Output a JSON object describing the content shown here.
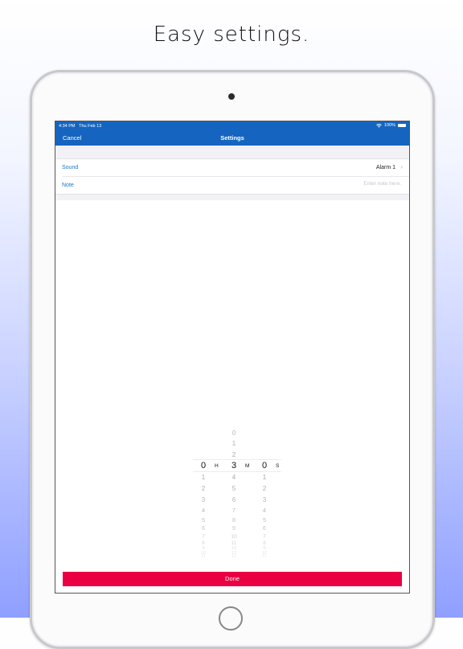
{
  "headline": "Easy settings.",
  "status": {
    "time": "4:34 PM",
    "date": "Thu Feb 13",
    "battery": "100%"
  },
  "nav": {
    "cancel": "Cancel",
    "title": "Settings"
  },
  "rows": {
    "sound": {
      "label": "Sound",
      "value": "Alarm 1"
    },
    "note": {
      "label": "Note",
      "placeholder": "Enter note here."
    }
  },
  "picker": {
    "hours": {
      "above": [],
      "selected": "0",
      "below": [
        "1",
        "2",
        "3",
        "4",
        "5",
        "6",
        "7",
        "8",
        "9",
        "10",
        "11"
      ],
      "unit": "H"
    },
    "minutes": {
      "above": [
        "0",
        "1",
        "2"
      ],
      "selected": "3",
      "below": [
        "4",
        "5",
        "6",
        "7",
        "8",
        "9",
        "10",
        "11",
        "12",
        "13",
        "14"
      ],
      "unit": "M"
    },
    "seconds": {
      "above": [],
      "selected": "0",
      "below": [
        "1",
        "2",
        "3",
        "4",
        "5",
        "6",
        "7",
        "8",
        "9",
        "10",
        "11"
      ],
      "unit": "S"
    }
  },
  "done": "Done",
  "colors": {
    "nav": "#1565c0",
    "accent": "#1976d2",
    "done": "#ea0042"
  }
}
